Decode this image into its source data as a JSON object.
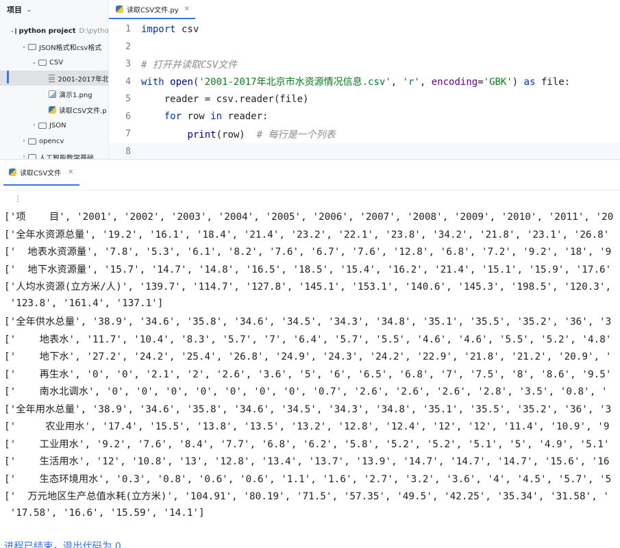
{
  "project_panel": {
    "title": "项目",
    "tree": [
      {
        "label": "python project",
        "sub": "D:\\python",
        "bold": true,
        "arrow": "⌄",
        "icon": "folder-icon",
        "depth": 0
      },
      {
        "label": "JSON格式和csv格式",
        "arrow": "⌄",
        "icon": "folder-icon",
        "depth": 1
      },
      {
        "label": "CSV",
        "arrow": "⌄",
        "icon": "folder-icon",
        "depth": 2
      },
      {
        "label": "2001-2017年北",
        "arrow": "",
        "icon": "csv-file-icon",
        "depth": 3,
        "selected": true
      },
      {
        "label": "演示1.png",
        "arrow": "",
        "icon": "png-file-icon",
        "depth": 3
      },
      {
        "label": "读取CSV文件.p",
        "arrow": "",
        "icon": "python-file-icon",
        "depth": 3
      },
      {
        "label": "JSON",
        "arrow": "›",
        "icon": "folder-icon",
        "depth": 2
      },
      {
        "label": "opencv",
        "arrow": "›",
        "icon": "folder-icon",
        "depth": 1
      },
      {
        "label": "人工智能数学基础",
        "arrow": "›",
        "icon": "folder-icon",
        "depth": 1
      }
    ]
  },
  "editor": {
    "tab_label": "读取CSV文件.py",
    "lines": [
      {
        "n": "1",
        "html": "<span class=\"kw\">import</span> csv"
      },
      {
        "n": "2",
        "html": ""
      },
      {
        "n": "3",
        "html": "<span class=\"cmt\"># 打开并读取CSV文件</span>"
      },
      {
        "n": "4",
        "html": "<span class=\"kw\">with</span> <span class=\"bi\">open</span>(<span class=\"str\">'2001-2017年北京市水资源情况信息.csv'</span>, <span class=\"str\">'r'</span>, <span class=\"kwarg\">encoding</span>=<span class=\"str\">'GBK'</span>) <span class=\"kw\">as</span> file:"
      },
      {
        "n": "5",
        "html": "    reader = csv.reader(file)"
      },
      {
        "n": "6",
        "html": "    <span class=\"kw\">for</span> row <span class=\"kw\">in</span> reader:"
      },
      {
        "n": "7",
        "html": "        <span class=\"bi\">print</span>(row)  <span class=\"cmt\"># 每行是一个列表</span>"
      },
      {
        "n": "8",
        "html": ""
      }
    ]
  },
  "run_panel": {
    "tab_label": "读取CSV文件",
    "output": [
      "['项    目', '2001', '2002', '2003', '2004', '2005', '2006', '2007', '2008', '2009', '2010', '2011', '20",
      "['全年水资源总量', '19.2', '16.1', '18.4', '21.4', '23.2', '22.1', '23.8', '34.2', '21.8', '23.1', '26.8'",
      "['  地表水资源量', '7.8', '5.3', '6.1', '8.2', '7.6', '6.7', '7.6', '12.8', '6.8', '7.2', '9.2', '18', '9",
      "['  地下水资源量', '15.7', '14.7', '14.8', '16.5', '18.5', '15.4', '16.2', '21.4', '15.1', '15.9', '17.6'",
      "['人均水资源(立方米/人)', '139.7', '114.7', '127.8', '145.1', '153.1', '140.6', '145.3', '198.5', '120.3',",
      " '123.8', '161.4', '137.1']",
      "['全年供水总量', '38.9', '34.6', '35.8', '34.6', '34.5', '34.3', '34.8', '35.1', '35.5', '35.2', '36', '3",
      "['    地表水', '11.7', '10.4', '8.3', '5.7', '7', '6.4', '5.7', '5.5', '4.6', '4.6', '5.5', '5.2', '4.8'",
      "['    地下水', '27.2', '24.2', '25.4', '26.8', '24.9', '24.3', '24.2', '22.9', '21.8', '21.2', '20.9', '",
      "['    再生水', '0', '0', '2.1', '2', '2.6', '3.6', '5', '6', '6.5', '6.8', '7', '7.5', '8', '8.6', '9.5'",
      "['    南水北调水', '0', '0', '0', '0', '0', '0', '0', '0.7', '2.6', '2.6', '2.6', '2.8', '3.5', '0.8', '",
      "['全年用水总量', '38.9', '34.6', '35.8', '34.6', '34.5', '34.3', '34.8', '35.1', '35.5', '35.2', '36', '3",
      "['     农业用水', '17.4', '15.5', '13.8', '13.5', '13.2', '12.8', '12.4', '12', '12', '11.4', '10.9', '9",
      "['    工业用水', '9.2', '7.6', '8.4', '7.7', '6.8', '6.2', '5.8', '5.2', '5.2', '5.1', '5', '4.9', '5.1'",
      "['    生活用水', '12', '10.8', '13', '12.8', '13.4', '13.7', '13.9', '14.7', '14.7', '14.7', '15.6', '16",
      "['    生态环境用水', '0.3', '0.8', '0.6', '0.6', '1.1', '1.6', '2.7', '3.2', '3.6', '4', '4.5', '5.7', '5",
      "['  万元地区生产总值水耗(立方米)', '104.91', '80.19', '71.5', '57.35', '49.5', '42.25', '35.34', '31.58', '",
      " '17.58', '16.6', '15.59', '14.1']"
    ],
    "exit_message": "进程已结束，退出代码为 0"
  }
}
